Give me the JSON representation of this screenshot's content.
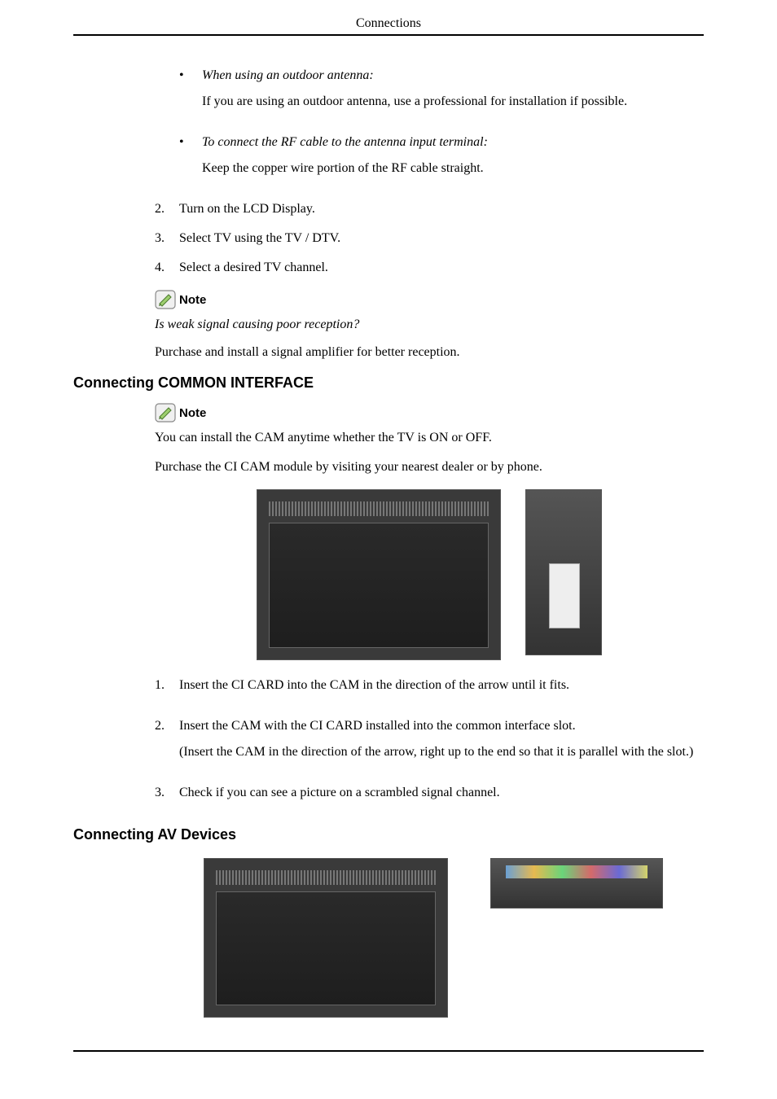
{
  "header": {
    "title": "Connections"
  },
  "bullets": [
    {
      "em": "When using an outdoor antenna:",
      "plain": "If you are using an outdoor antenna, use a professional for installation if possible."
    },
    {
      "em": "To connect the RF cable to the antenna input terminal:",
      "plain": "Keep the copper wire portion of the RF cable straight."
    }
  ],
  "first_list": [
    {
      "num": "2.",
      "text": "Turn on the LCD Display."
    },
    {
      "num": "3.",
      "text": "Select TV using the TV / DTV."
    },
    {
      "num": "4.",
      "text": "Select a desired TV channel."
    }
  ],
  "note_label": "Note",
  "italic_q": "Is weak signal causing poor reception?",
  "amp_line": "Purchase and install a signal amplifier for better reception.",
  "section1": "Connecting COMMON INTERFACE",
  "note2_label": "Note",
  "cam_line1": "You can install the CAM anytime whether the TV is ON or OFF.",
  "cam_line2": "Purchase the CI CAM module by visiting your nearest dealer or by phone.",
  "second_list": [
    {
      "num": "1.",
      "text": "Insert the CI CARD into the CAM in the direction of the arrow until it fits.",
      "extra": ""
    },
    {
      "num": "2.",
      "text": "Insert the CAM with the CI CARD installed into the common interface slot.",
      "extra": "(Insert the CAM in the direction of the arrow, right up to the end so that it is parallel with the slot.)"
    },
    {
      "num": "3.",
      "text": "Check if you can see a picture on a scrambled signal channel.",
      "extra": ""
    }
  ],
  "section2": "Connecting AV Devices",
  "icons": {
    "note": "pencil-note-icon"
  }
}
